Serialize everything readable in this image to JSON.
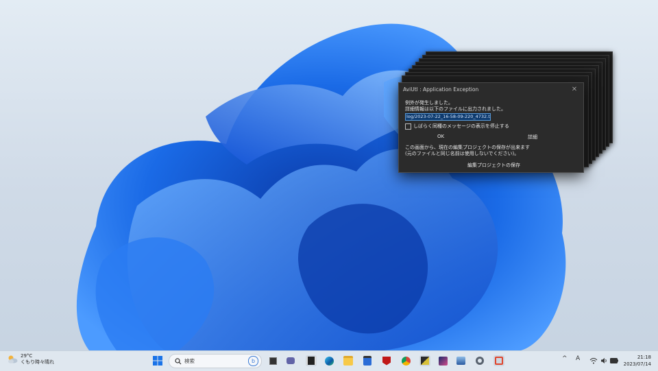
{
  "dialog": {
    "title": "AviUtl : Application Exception",
    "close_glyph": "✕",
    "message_line1": "例外が発生しました。",
    "message_line2": "詳細情報は以下のファイルに出力されました。",
    "file_path": "log/2023-07-22_16-58-09-220_4732.txt",
    "checkbox_label": "しばらく同種のメッセージの表示を停止する",
    "checkbox_checked": false,
    "ok_label": "OK",
    "details_label": "詳細",
    "note_line1": "この画面から、現在の編集プロジェクトの保存が出来ます",
    "note_line2": "(元のファイルと同じ名前は使用しないでください)。",
    "save_label": "編集プロジェクトの保存"
  },
  "taskbar": {
    "weather_temp": "29°C",
    "weather_desc": "くもり時々晴れ",
    "search_placeholder": "検索",
    "apps": [
      "start-icon",
      "search-icon",
      "bing-icon",
      "task-view-icon",
      "teams-chat-icon",
      "film-icon",
      "edge-icon",
      "file-explorer-icon",
      "store-icon",
      "mcafee-icon",
      "chrome-icon",
      "aviutl-icon",
      "media-player-icon",
      "photos-icon",
      "settings-icon",
      "snipping-tool-icon"
    ],
    "ime": "A",
    "time": "21:18",
    "date": "2023/07/14"
  },
  "colors": {
    "accent": "#0a64d8",
    "dialog_bg": "#2b2b2b",
    "taskbar_bg": "#dfe7ef"
  }
}
